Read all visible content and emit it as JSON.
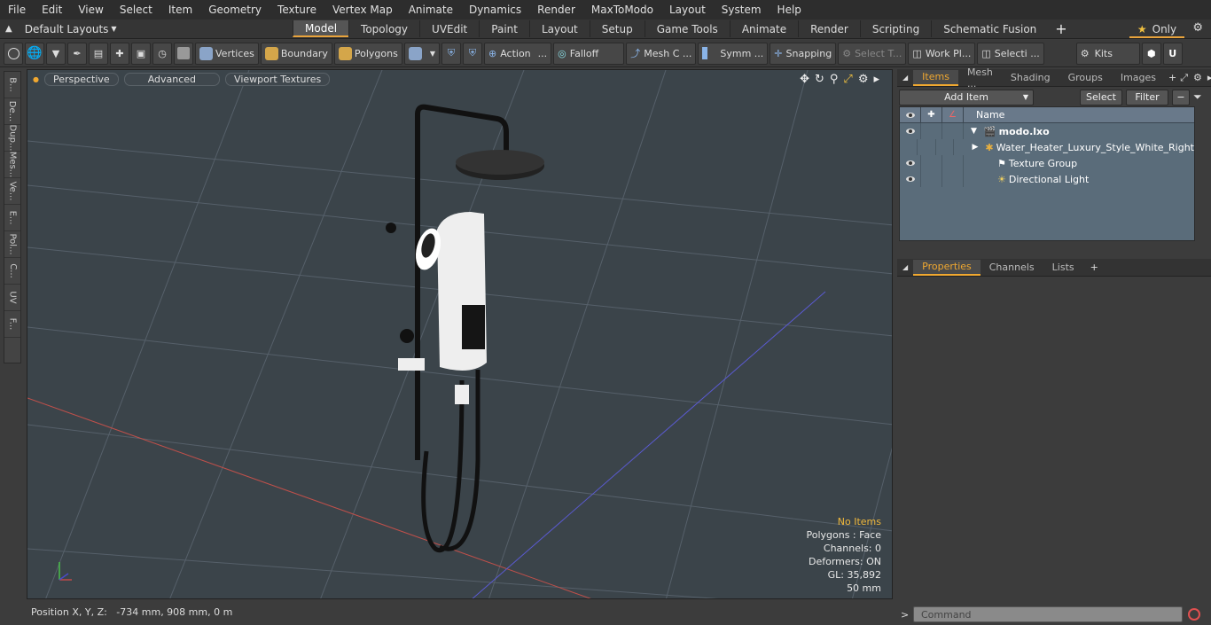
{
  "menu": [
    "File",
    "Edit",
    "View",
    "Select",
    "Item",
    "Geometry",
    "Texture",
    "Vertex Map",
    "Animate",
    "Dynamics",
    "Render",
    "MaxToModo",
    "Layout",
    "System",
    "Help"
  ],
  "layout_dropdown": "Default Layouts",
  "tabs": [
    "Model",
    "Topology",
    "UVEdit",
    "Paint",
    "Layout",
    "Setup",
    "Game Tools",
    "Animate",
    "Render",
    "Scripting",
    "Schematic Fusion"
  ],
  "tabs_plus": "+",
  "only_label": "Only",
  "toolbar": {
    "vertices": "Vertices",
    "boundary": "Boundary",
    "polygons": "Polygons",
    "action": "Action",
    "falloff": "Falloff",
    "mesh_c": "Mesh C ...",
    "symm": "Symm ...",
    "snapping": "Snapping",
    "select_t": "Select T...",
    "work_pl": "Work Pl...",
    "selecti": "Selecti ...",
    "kits": "Kits"
  },
  "left_tabs": [
    "B...",
    "De...",
    "Dup...",
    "Mes...",
    "Ve...",
    "E...",
    "Pol...",
    "C...",
    "UV",
    "F..."
  ],
  "viewport": {
    "perspective": "Perspective",
    "advanced": "Advanced",
    "viewport_textures": "Viewport Textures",
    "info": {
      "no_items": "No Items",
      "polygons": "Polygons : Face",
      "channels": "Channels: 0",
      "deformers": "Deformers: ON",
      "gl": "GL: 35,892",
      "mm": "50 mm"
    }
  },
  "status": "Position X, Y, Z:   -734 mm, 908 mm, 0 m",
  "right_panel": {
    "top_tabs": [
      "Items",
      "Mesh ...",
      "Shading",
      "Groups",
      "Images"
    ],
    "add_item": "Add Item",
    "select": "Select",
    "filter": "Filter",
    "name_header": "Name",
    "tree": [
      {
        "label": "modo.lxo"
      },
      {
        "label": "Water_Heater_Luxury_Style_White_Right"
      },
      {
        "label": "Texture Group"
      },
      {
        "label": "Directional Light"
      }
    ],
    "bottom_tabs": [
      "Properties",
      "Channels",
      "Lists"
    ],
    "command_placeholder": "Command"
  },
  "colors": {
    "accent": "#f0a830",
    "viewport_bg": "#3b444a",
    "tree_bg": "#5a6c7a"
  }
}
